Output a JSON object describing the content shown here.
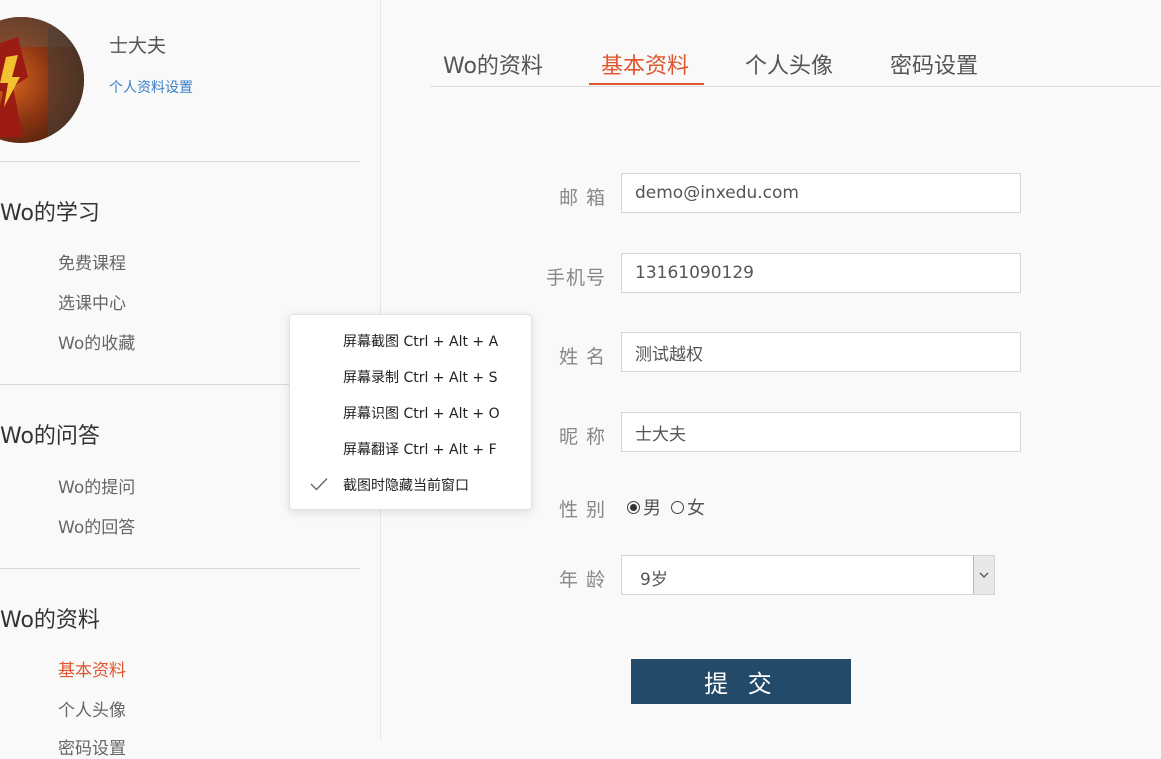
{
  "user": {
    "name": "士大夫",
    "profile_link": "个人资料设置"
  },
  "sidebar": {
    "sections": [
      {
        "title": "Wo的学习",
        "items": [
          "免费课程",
          "选课中心",
          "Wo的收藏"
        ]
      },
      {
        "title": "Wo的问答",
        "items": [
          "Wo的提问",
          "Wo的回答"
        ]
      },
      {
        "title": "Wo的资料",
        "items": [
          "基本资料",
          "个人头像",
          "密码设置"
        ]
      }
    ],
    "active_item": "基本资料"
  },
  "tabs": [
    "Wo的资料",
    "基本资料",
    "个人头像",
    "密码设置"
  ],
  "active_tab": "基本资料",
  "form": {
    "email": {
      "label": "邮 箱",
      "value": "demo@inxedu.com"
    },
    "phone": {
      "label": "手机号",
      "value": "13161090129"
    },
    "name": {
      "label": "姓 名",
      "value": "测试越权"
    },
    "nickname": {
      "label": "昵 称",
      "value": "士大夫"
    },
    "gender": {
      "label": "性 别",
      "options": [
        "男",
        "女"
      ],
      "selected": "男"
    },
    "age": {
      "label": "年 龄",
      "value": "9岁"
    },
    "submit": "提 交"
  },
  "context_menu": {
    "items": [
      "屏幕截图 Ctrl + Alt + A",
      "屏幕录制 Ctrl + Alt + S",
      "屏幕识图 Ctrl + Alt + O",
      "屏幕翻译 Ctrl + Alt + F",
      "截图时隐藏当前窗口"
    ],
    "checked_item": "截图时隐藏当前窗口"
  },
  "colors": {
    "accent": "#e0552d",
    "submit_bg": "#234a68",
    "link": "#3b7fc4"
  },
  "icons": {
    "check": "check-icon",
    "dropdown": "chevron-down-icon"
  }
}
